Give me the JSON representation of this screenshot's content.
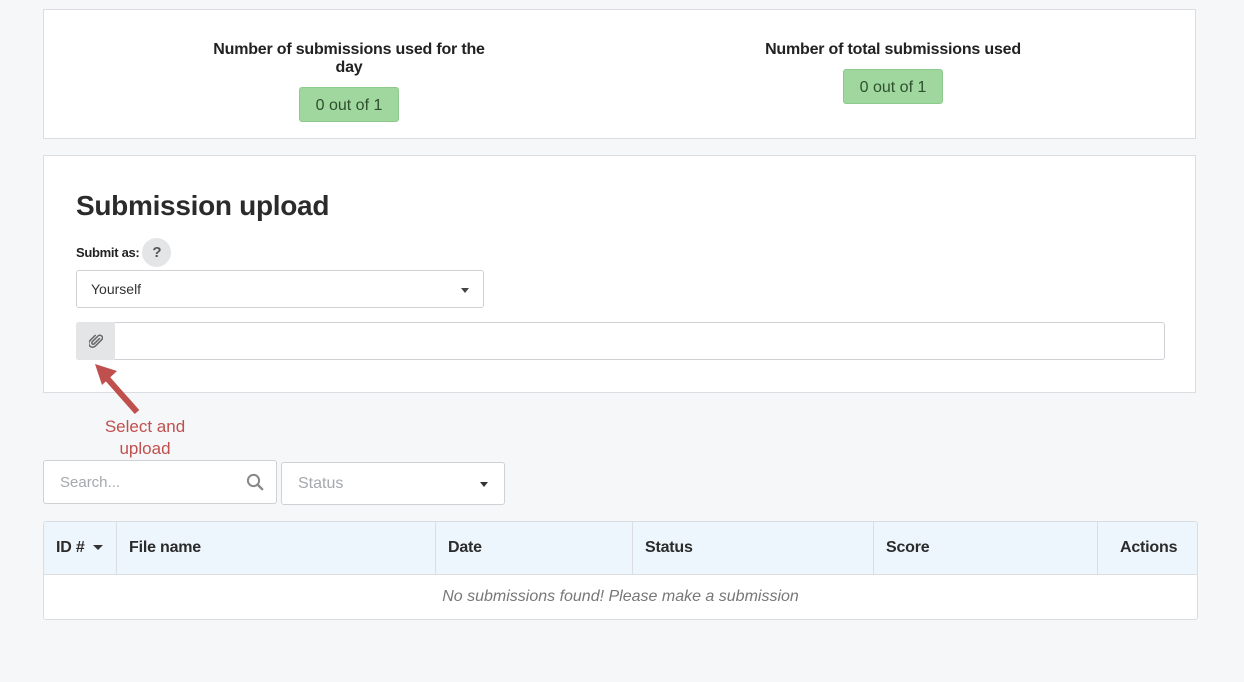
{
  "quota": {
    "daily": {
      "label": "Number of submissions used for the day",
      "value": "0 out of 1"
    },
    "total": {
      "label": "Number of total submissions used",
      "value": "0 out of 1"
    },
    "badge_color": "#9fd79f"
  },
  "upload": {
    "title": "Submission upload",
    "submit_as_label": "Submit as:",
    "help_icon": "?",
    "submit_as_value": "Yourself",
    "attach_icon": "paperclip-icon"
  },
  "annotation": {
    "text": "Select and upload",
    "color": "#c0504d"
  },
  "filters": {
    "search_placeholder": "Search...",
    "status_placeholder": "Status"
  },
  "table": {
    "columns": [
      "ID #",
      "File name",
      "Date",
      "Status",
      "Score",
      "Actions"
    ],
    "empty_message": "No submissions found! Please make a submission"
  }
}
